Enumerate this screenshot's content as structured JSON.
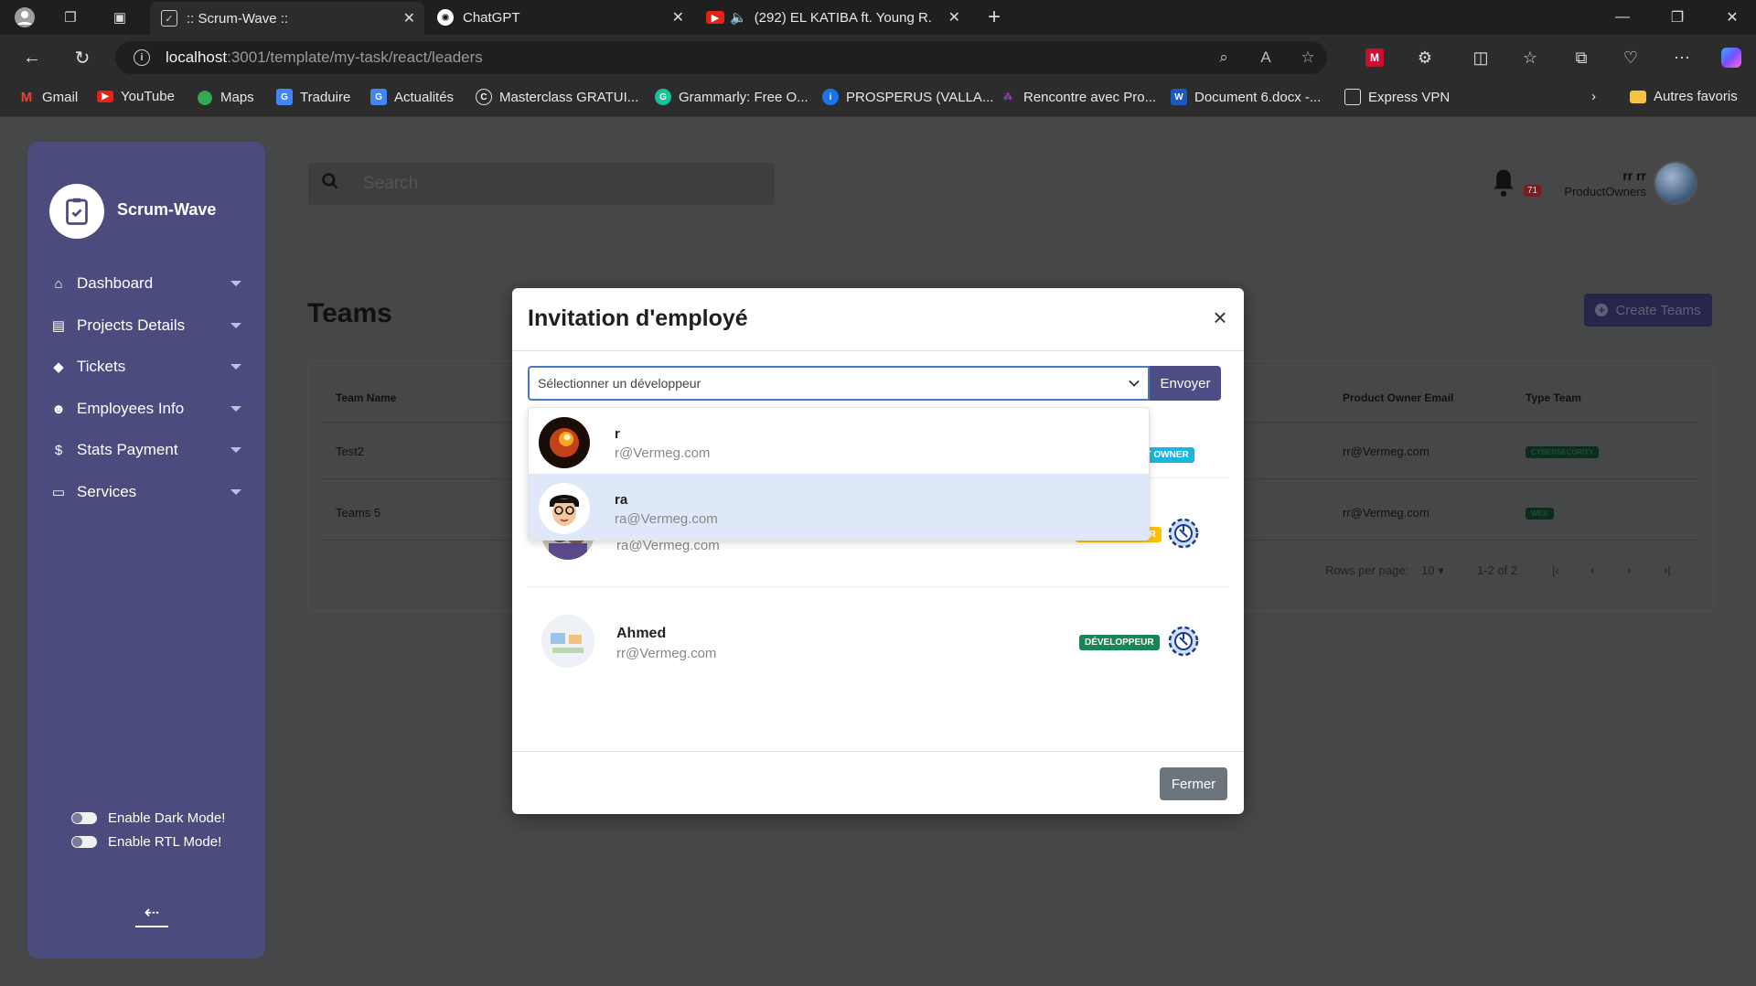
{
  "browser": {
    "tabs": [
      {
        "title": ":: Scrum-Wave ::",
        "active": true
      },
      {
        "title": "ChatGPT",
        "active": false
      },
      {
        "title": "(292) EL KATIBA ft. Young R.",
        "active": false
      }
    ],
    "url_host": "localhost",
    "url_path": ":3001/template/my-task/react/leaders",
    "bookmarks": [
      "Gmail",
      "YouTube",
      "Maps",
      "Traduire",
      "Actualités",
      "Masterclass GRATUI...",
      "Grammarly: Free O...",
      "PROSPERUS (VALLA...",
      "Rencontre avec Pro...",
      "Document 6.docx -...",
      "Express VPN"
    ],
    "other_favorites": "Autres favoris"
  },
  "sidebar": {
    "brand": "Scrum-Wave",
    "items": [
      {
        "label": "Dashboard",
        "icon": "home-icon"
      },
      {
        "label": "Projects Details",
        "icon": "briefcase-icon"
      },
      {
        "label": "Tickets",
        "icon": "ticket-icon"
      },
      {
        "label": "Employees Info",
        "icon": "users-icon"
      },
      {
        "label": "Stats Payment",
        "icon": "money-icon"
      },
      {
        "label": "Services",
        "icon": "monitor-icon"
      }
    ],
    "dark_mode_label": "Enable Dark Mode!",
    "rtl_mode_label": "Enable RTL Mode!"
  },
  "header": {
    "search_placeholder": "Search",
    "notification_count": "71",
    "user_name": "rr rr",
    "user_role": "ProductOwners"
  },
  "page": {
    "title": "Teams",
    "create_button": "Create Teams",
    "table": {
      "columns": [
        "Team Name",
        "Product Owner Email",
        "Type Team"
      ],
      "rows": [
        {
          "team": "Test2",
          "email": "rr@Vermeg.com",
          "type": "CYBERSECURITY"
        },
        {
          "team": "Teams 5",
          "email": "rr@Vermeg.com",
          "type": "WEB"
        }
      ],
      "rows_per_page_label": "Rows per page:",
      "rows_per_page": "10",
      "range": "1-2 of 2"
    }
  },
  "modal": {
    "title": "Invitation d'employé",
    "select_placeholder": "Sélectionner un développeur",
    "send_button": "Envoyer",
    "dropdown_options": [
      {
        "name": "r",
        "email": "r@Vermeg.com"
      },
      {
        "name": "ra",
        "email": "ra@Vermeg.com"
      }
    ],
    "hidden_role_fragment": "UCT OWNER",
    "members": [
      {
        "name": "ra",
        "email": "ra@Vermeg.com",
        "role": "SCRUM MASTER"
      },
      {
        "name": "Ahmed",
        "email": "rr@Vermeg.com",
        "role": "DÉVELOPPEUR"
      }
    ],
    "close_button": "Fermer"
  }
}
